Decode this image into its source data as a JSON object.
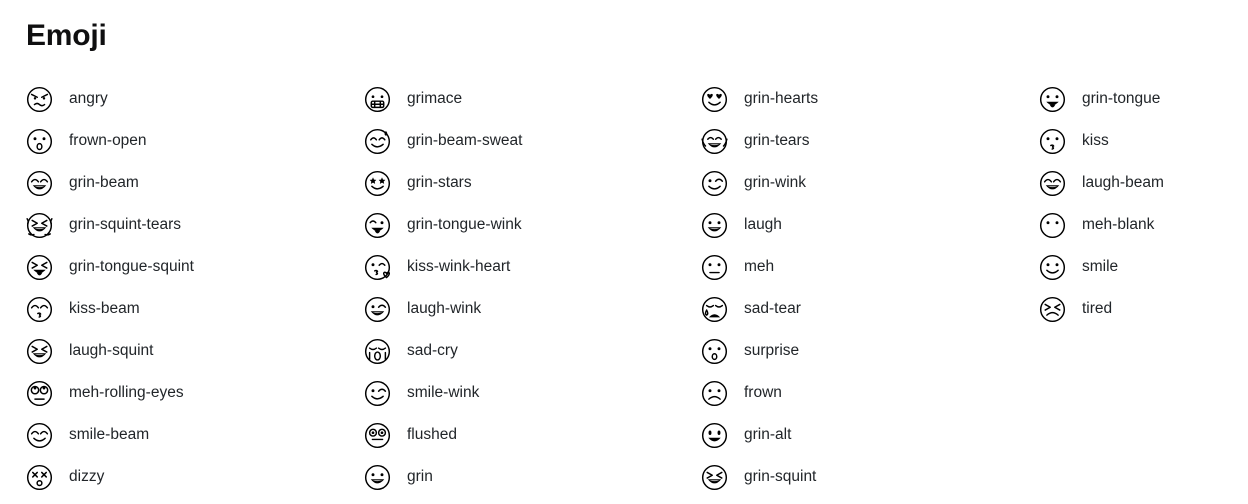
{
  "page": {
    "title": "Emoji",
    "background_color": "#ffffff",
    "text_color": "#212529",
    "icon_color": "#000000"
  },
  "grid": {
    "columns": 4,
    "rows": 10,
    "order": "column-major"
  },
  "emoji": [
    {
      "icon": "angry-icon",
      "label": "angry"
    },
    {
      "icon": "frown-open-icon",
      "label": "frown-open"
    },
    {
      "icon": "grin-beam-icon",
      "label": "grin-beam"
    },
    {
      "icon": "grin-squint-tears-icon",
      "label": "grin-squint-tears"
    },
    {
      "icon": "grin-tongue-squint-icon",
      "label": "grin-tongue-squint"
    },
    {
      "icon": "kiss-beam-icon",
      "label": "kiss-beam"
    },
    {
      "icon": "laugh-squint-icon",
      "label": "laugh-squint"
    },
    {
      "icon": "meh-rolling-eyes-icon",
      "label": "meh-rolling-eyes"
    },
    {
      "icon": "smile-beam-icon",
      "label": "smile-beam"
    },
    {
      "icon": "dizzy-icon",
      "label": "dizzy"
    },
    {
      "icon": "grimace-icon",
      "label": "grimace"
    },
    {
      "icon": "grin-beam-sweat-icon",
      "label": "grin-beam-sweat"
    },
    {
      "icon": "grin-stars-icon",
      "label": "grin-stars"
    },
    {
      "icon": "grin-tongue-wink-icon",
      "label": "grin-tongue-wink"
    },
    {
      "icon": "kiss-wink-heart-icon",
      "label": "kiss-wink-heart"
    },
    {
      "icon": "laugh-wink-icon",
      "label": "laugh-wink"
    },
    {
      "icon": "sad-cry-icon",
      "label": "sad-cry"
    },
    {
      "icon": "smile-wink-icon",
      "label": "smile-wink"
    },
    {
      "icon": "flushed-icon",
      "label": "flushed"
    },
    {
      "icon": "grin-icon",
      "label": "grin"
    },
    {
      "icon": "grin-hearts-icon",
      "label": "grin-hearts"
    },
    {
      "icon": "grin-tears-icon",
      "label": "grin-tears"
    },
    {
      "icon": "grin-wink-icon",
      "label": "grin-wink"
    },
    {
      "icon": "laugh-icon",
      "label": "laugh"
    },
    {
      "icon": "meh-icon",
      "label": "meh"
    },
    {
      "icon": "sad-tear-icon",
      "label": "sad-tear"
    },
    {
      "icon": "surprise-icon",
      "label": "surprise"
    },
    {
      "icon": "frown-icon",
      "label": "frown"
    },
    {
      "icon": "grin-alt-icon",
      "label": "grin-alt"
    },
    {
      "icon": "grin-squint-icon",
      "label": "grin-squint"
    },
    {
      "icon": "grin-tongue-icon",
      "label": "grin-tongue"
    },
    {
      "icon": "kiss-icon",
      "label": "kiss"
    },
    {
      "icon": "laugh-beam-icon",
      "label": "laugh-beam"
    },
    {
      "icon": "meh-blank-icon",
      "label": "meh-blank"
    },
    {
      "icon": "smile-icon",
      "label": "smile"
    },
    {
      "icon": "tired-icon",
      "label": "tired"
    }
  ]
}
